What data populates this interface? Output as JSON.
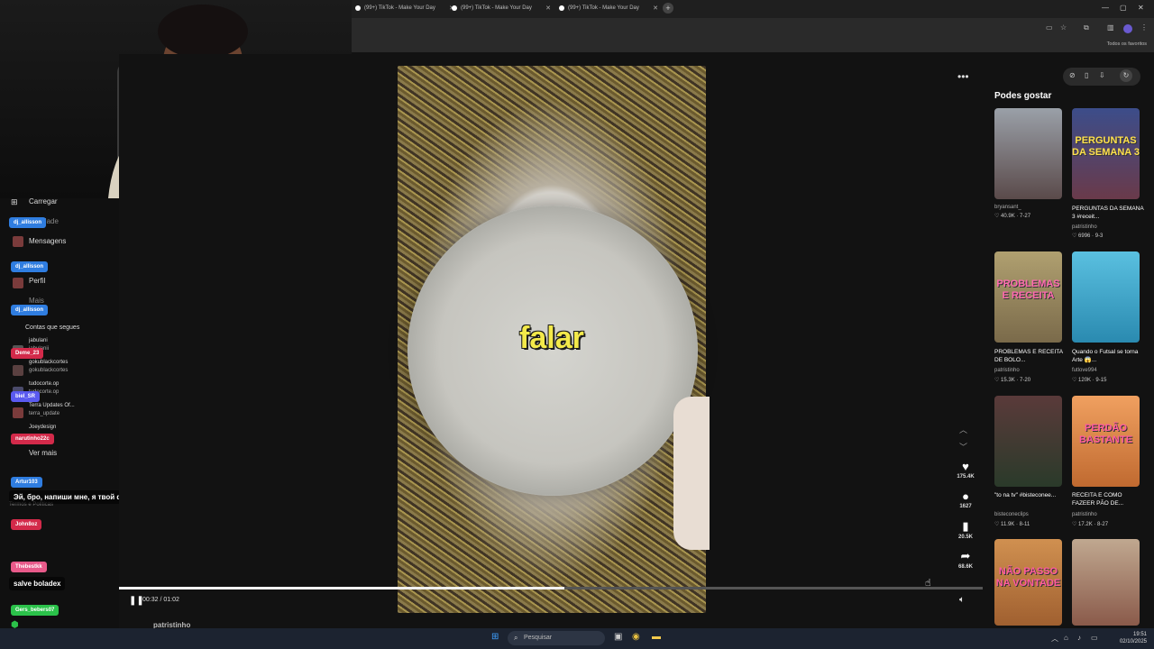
{
  "browser": {
    "tabs": [
      {
        "title": "(99+) TikTok - Make Your Day"
      },
      {
        "title": "(99+) TikTok - Make Your Day"
      },
      {
        "title": "(99+) TikTok - Make Your Day"
      }
    ],
    "bookmarks_label": "Todos os favoritos"
  },
  "sidebar": {
    "items": [
      {
        "label": "Carregar"
      },
      {
        "label": "Atividade"
      },
      {
        "label": "Mensagens"
      },
      {
        "label": "Perfil"
      },
      {
        "label": "Mais"
      },
      {
        "label": "Contas que segues"
      }
    ],
    "following": [
      {
        "name": "jabulani",
        "sub": "jabulanii"
      },
      {
        "name": "gokublackcortes",
        "sub": "gokublackcortes"
      },
      {
        "name": "tudocorte.op",
        "sub": "tudocorte.op"
      },
      {
        "name": "Terra Updates Of...",
        "sub": "terra_update"
      },
      {
        "name": "Joeydesign",
        "sub": ""
      }
    ],
    "see_more": "Ver mais",
    "footer": "Termos e Políticas"
  },
  "chat": [
    {
      "user": "dj_allisson",
      "color": "#2f7de0"
    },
    {
      "user": "dj_allisson",
      "color": "#2f7de0"
    },
    {
      "user": "dj_allisson",
      "color": "#2f7de0"
    },
    {
      "user": "Deme_23",
      "color": "#d32a4a"
    },
    {
      "user": "biel_SR",
      "color": "#5a5af0"
    },
    {
      "user": "narutinho22c",
      "color": "#d32a4a"
    },
    {
      "user": "Artur103",
      "color": "#2f7de0",
      "message": "Эй, бро, напиши мне, я твой фанат."
    },
    {
      "user": "John8oz",
      "color": "#d32a4a"
    },
    {
      "user": "Thebestkk",
      "color": "#e85a8a",
      "message": "salve boladex"
    },
    {
      "user": "Gers_bebers07",
      "color": "#2bc24a"
    }
  ],
  "video": {
    "caption": "falar",
    "time": "00:32 / 01:02",
    "progress": 0.516,
    "author": "patristinho",
    "actions": [
      {
        "icon": "heart-icon",
        "glyph": "♥",
        "count": "175.4K"
      },
      {
        "icon": "comment-icon",
        "glyph": "●",
        "count": "1627"
      },
      {
        "icon": "bookmark-icon",
        "glyph": "▮",
        "count": "20.5K"
      },
      {
        "icon": "share-icon",
        "glyph": "➦",
        "count": "68.6K"
      }
    ]
  },
  "recommendations": {
    "title": "Podes gostar",
    "cards": [
      {
        "title": "",
        "author": "bryansant_",
        "stats": "♡ 40.9K · 7-27",
        "thumb_text": "",
        "bg": "#6b6a63"
      },
      {
        "title": "PERGUNTAS DA SEMANA 3 #receit...",
        "author": "patristinho",
        "stats": "♡ 6996 · 9-3",
        "thumb_text": "PERGUNTAS DA SEMANA 3",
        "bg": "#4b5a8a"
      },
      {
        "title": "PROBLEMAS E RECEITA DE BOLO...",
        "author": "patristinho",
        "stats": "♡ 15.3K · 7-20",
        "thumb_text": "PROBLEMAS E RECEITA",
        "bg": "#8a8a5a"
      },
      {
        "title": "Quando o Futsal se torna Arte 😱...",
        "author": "futlove994",
        "stats": "♡ 120K · 9-15",
        "thumb_text": "",
        "bg": "#3a9ab0"
      },
      {
        "title": "\"to na tv\" #bisteconee...",
        "author": "bisteconeclips",
        "stats": "♡ 11.9K · 8-11",
        "thumb_text": "",
        "bg": "#3a2a3a"
      },
      {
        "title": "RECEITA E COMO FAZEER PÃO DE...",
        "author": "patristinho",
        "stats": "♡ 17.2K · 8-27",
        "thumb_text": "PERDÃO BASTANTE",
        "bg": "#d98a4a"
      },
      {
        "title": "",
        "author": "",
        "stats": "",
        "thumb_text": "NÃO PASSO NA VONTADE",
        "bg": "#c08040"
      },
      {
        "title": "",
        "author": "",
        "stats": "",
        "thumb_text": "",
        "bg": "#8a6a5a"
      }
    ]
  },
  "taskbar": {
    "search_placeholder": "Pesquisar",
    "time": "19:51",
    "date": "02/10/2025"
  }
}
